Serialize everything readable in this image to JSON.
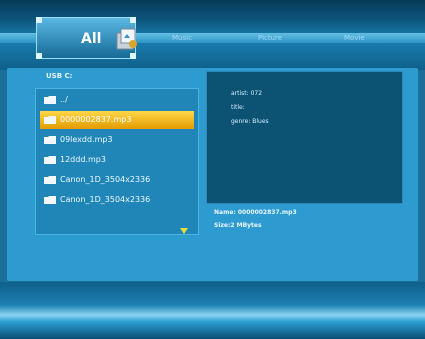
{
  "tabs": {
    "active": "All",
    "others": [
      "Music",
      "Picture",
      "Movie"
    ]
  },
  "browser": {
    "path": "USB   C:",
    "items": [
      {
        "label": "../",
        "selected": false
      },
      {
        "label": "0000002837.mp3",
        "selected": true
      },
      {
        "label": "09lexdd.mp3",
        "selected": false
      },
      {
        "label": "12ddd.mp3",
        "selected": false
      },
      {
        "label": "Canon_1D_3504x2336",
        "selected": false
      },
      {
        "label": "Canon_1D_3504x2336",
        "selected": false
      }
    ]
  },
  "info": {
    "artist": "artist: 072",
    "title": "title:",
    "genre": "genre: Blues"
  },
  "meta": {
    "name": "Name: 0000002837.mp3",
    "size": "Size:2 MBytes"
  },
  "colors": {
    "background": "#1c6f9a",
    "selection": "#f2b100",
    "panel": "#0c5273"
  }
}
